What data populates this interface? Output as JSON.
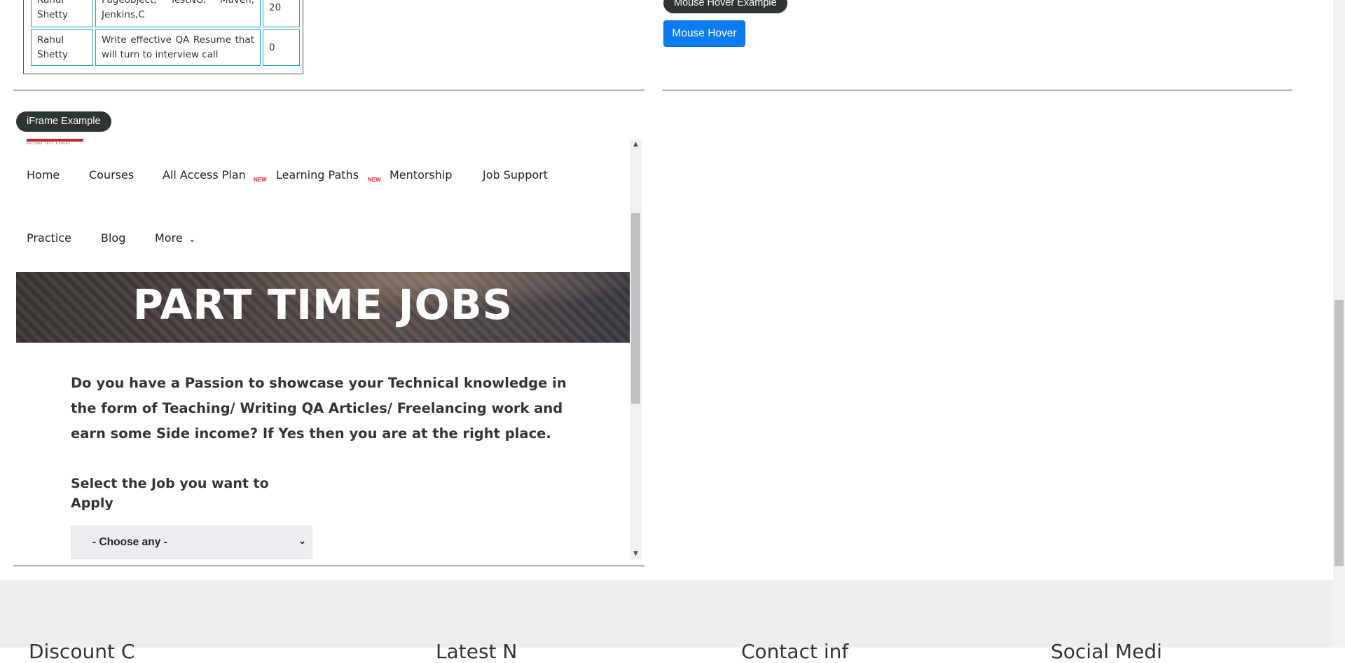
{
  "table": {
    "rows": [
      {
        "instructor": "Rahul Shetty",
        "course": "Pageobject, TestNG, Maven, Jenkins,C",
        "price": "20"
      },
      {
        "instructor": "Rahul Shetty",
        "course": "Write effective QA Resume that will turn to interview call",
        "price": "0"
      }
    ]
  },
  "mouse_hover": {
    "section_label": "Mouse Hover Example",
    "button_label": "Mouse Hover"
  },
  "iframe_section": {
    "label": "iFrame Example",
    "logo_text": "BECOME TEST EXPERT",
    "nav": {
      "home": "Home",
      "courses": "Courses",
      "all_access": "All Access Plan",
      "all_access_badge": "NEW",
      "learning_paths": "Learning Paths",
      "learning_paths_badge": "NEW",
      "mentorship": "Mentorship",
      "job_support": "Job Support",
      "practice": "Practice",
      "blog": "Blog",
      "more": "More"
    },
    "banner_title": "PART TIME JOBS",
    "intro_text": "Do you have a Passion to showcase your Technical knowledge in the form of Teaching/ Writing QA Articles/ Freelancing work and earn some Side income? If Yes then you are at the right place.",
    "select_label": "Select the Job you want to Apply",
    "select_value": "- Choose any -"
  },
  "footer": {
    "col1": "Discount C",
    "col2": "Latest N",
    "col3": "Contact inf",
    "col4": "Social Medi"
  },
  "colors": {
    "pill_bg": "#2d3434",
    "button_bg": "#0a7cf0",
    "table_border": "#20a0b8",
    "new_badge": "#e0262c",
    "footer_bg": "#ededee"
  }
}
